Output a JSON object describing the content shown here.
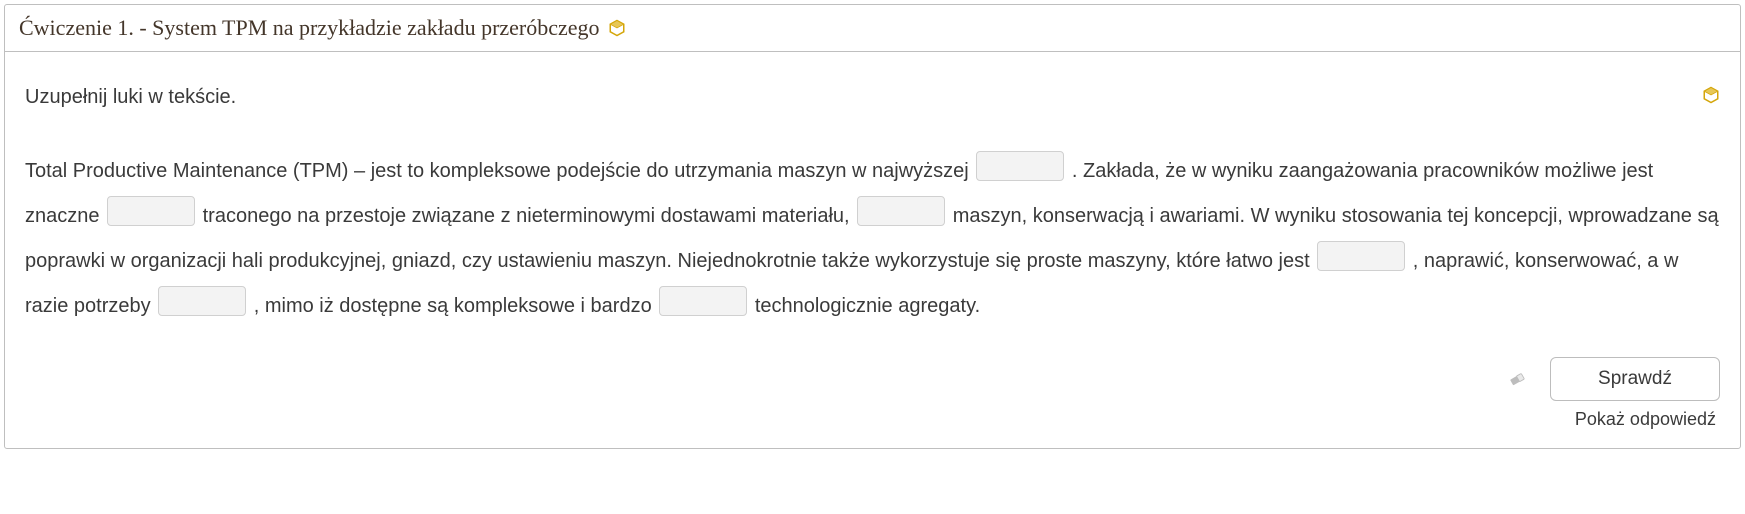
{
  "header": {
    "title": "Ćwiczenie 1. - System TPM na przykładzie zakładu przeróbczego"
  },
  "instruction": "Uzupełnij luki w tekście.",
  "exercise": {
    "segments": [
      "Total Productive Maintenance (TPM) – jest to kompleksowe podejście do utrzymania maszyn w najwyższej ",
      ". Zakłada, że w wyniku zaangażowania pracowników możliwe jest znaczne ",
      " traconego na przestoje związane z nieterminowymi dostawami materiału, ",
      " maszyn, konserwacją i awariami. W wyniku stosowania tej koncepcji, wprowadzane są poprawki w organizacji hali produkcyjnej, gniazd, czy ustawieniu maszyn. Niejednokrotnie także wykorzystuje się proste maszyny, które łatwo jest ",
      ", naprawić, konserwować, a w razie potrzeby ",
      ", mimo iż dostępne są kompleksowe i bardzo ",
      " technologicznie agregaty."
    ]
  },
  "actions": {
    "check_label": "Sprawdź",
    "show_answer_label": "Pokaż odpowiedź"
  },
  "icons": {
    "hex": "hex-icon",
    "eraser": "eraser-icon"
  },
  "colors": {
    "gold": "#d4a60a"
  }
}
